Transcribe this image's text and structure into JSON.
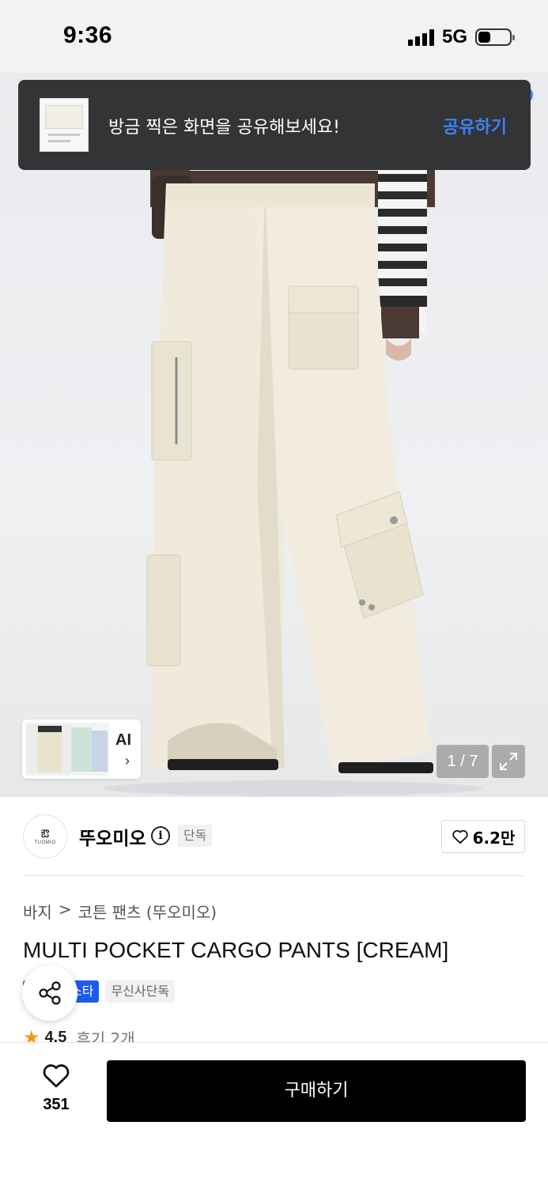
{
  "status_bar": {
    "time": "9:36",
    "network": "5G"
  },
  "toast": {
    "message": "방금 찍은 화면을 공유해보세요!",
    "action": "공유하기"
  },
  "gallery": {
    "ai_label": "AI",
    "ai_chevron": "›",
    "counter": "1 / 7"
  },
  "brand": {
    "name": "뚜오미오",
    "logo_text": "TUOMIO",
    "badge": "단독",
    "likes": "6.2만"
  },
  "breadcrumb": {
    "category": "바지",
    "separator": ">",
    "subcategory": "코튼 팬츠 (뚜오미오)"
  },
  "product": {
    "title": "MULTI POCKET CARGO PANTS [CREAM]",
    "tags": [
      "스타",
      "무신사단독"
    ],
    "rating": "4.5",
    "reviews": "후기 2개"
  },
  "bottom_bar": {
    "wish_count": "351",
    "buy_label": "구매하기"
  },
  "colors": {
    "accent_blue": "#1d5bf0",
    "link_blue": "#3b82f6",
    "star": "#f39c12",
    "toast_bg": "#333436"
  }
}
